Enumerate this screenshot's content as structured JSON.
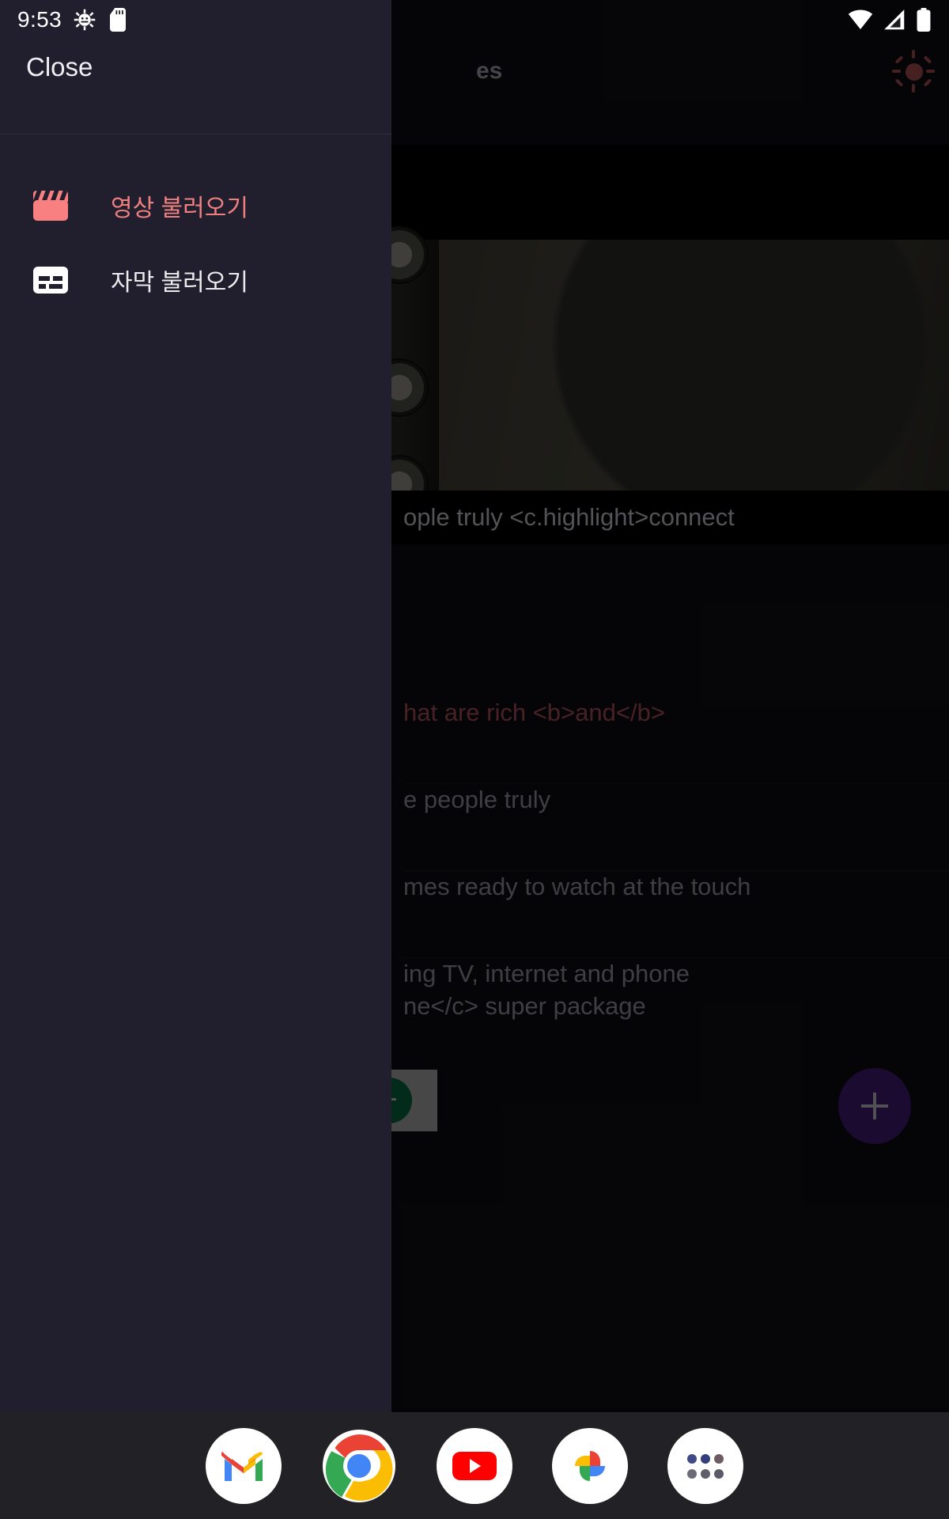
{
  "status_bar": {
    "time": "9:53",
    "left_icons": [
      "android-debug-icon",
      "sd-card-icon"
    ],
    "right_icons": [
      "wifi-icon",
      "cellular-signal-icon",
      "battery-icon"
    ]
  },
  "app": {
    "title": "es",
    "brightness_icon": "sun-icon",
    "video_subtitle": "ople truly <c.highlight>connect",
    "rows": [
      {
        "text": "hat are rich <b>and</b>",
        "highlight": true
      },
      {
        "text": "e people truly",
        "highlight": false
      },
      {
        "text": "mes ready to watch at the touch",
        "highlight": false
      },
      {
        "text": "ing TV, internet and phone\nne</c> super package",
        "highlight": false
      }
    ],
    "fab": {
      "icon": "plus-icon",
      "color": "#3c1a6b"
    },
    "chip": {
      "icon": "green-circle-icon",
      "color": "#06603f"
    }
  },
  "drawer": {
    "close_label": "Close",
    "items": [
      {
        "label": "영상 불러오기",
        "icon": "movie-clapper-icon",
        "color": "#f08080"
      },
      {
        "label": "자막 불러오기",
        "icon": "subtitles-icon",
        "color": "#ececed"
      }
    ]
  },
  "dock": {
    "apps": [
      {
        "name": "gmail-icon"
      },
      {
        "name": "chrome-icon"
      },
      {
        "name": "youtube-icon"
      },
      {
        "name": "google-photos-icon"
      },
      {
        "name": "app-drawer-icon"
      }
    ]
  },
  "colors": {
    "drawer_bg": "#211f2e",
    "app_bg": "#0d0d12",
    "accent_pink": "#f08080",
    "accent_red_text": "#a04b52",
    "fab_purple": "#3c1a6b",
    "dock_bg": "#222226"
  }
}
